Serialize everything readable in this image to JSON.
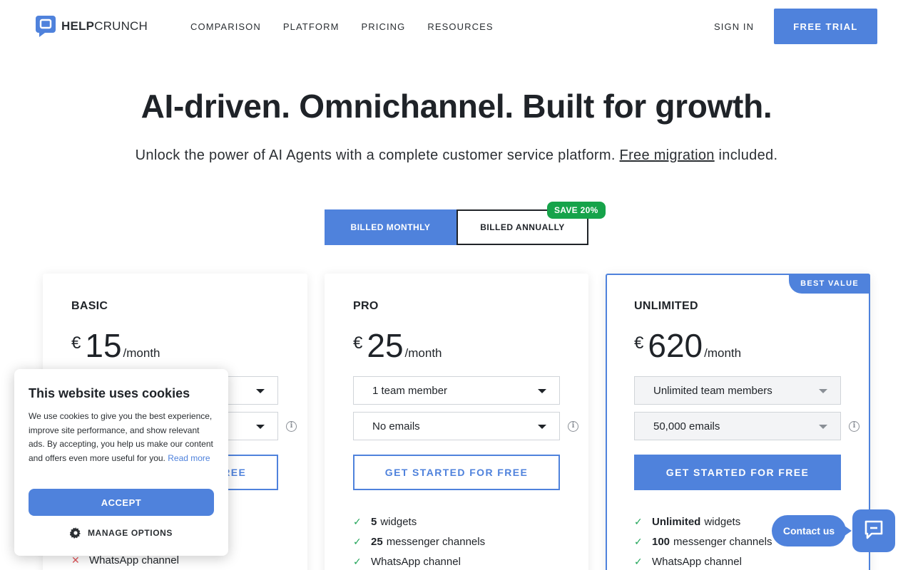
{
  "nav": {
    "logo_bold": "HELP",
    "logo_light": "CRUNCH",
    "links": [
      "COMPARISON",
      "PLATFORM",
      "PRICING",
      "RESOURCES"
    ],
    "sign_in": "SIGN IN",
    "free_trial": "FREE TRIAL"
  },
  "hero": {
    "title": "AI-driven. Omnichannel. Built for growth.",
    "sub_before": "Unlock the power of AI Agents with a complete customer service platform. ",
    "sub_link": "Free migration",
    "sub_after": " included."
  },
  "billing": {
    "monthly": "BILLED MONTHLY",
    "annually": "BILLED ANNUALLY",
    "save_badge": "SAVE 20%",
    "selected": "monthly"
  },
  "plans": [
    {
      "name": "BASIC",
      "currency": "€",
      "amount": "15",
      "per": "/month",
      "select1": "",
      "select2": "",
      "cta": "GET STARTED FOR FREE",
      "features": [
        {
          "mark": "x",
          "bold": "",
          "text": "WhatsApp channel"
        }
      ]
    },
    {
      "name": "PRO",
      "currency": "€",
      "amount": "25",
      "per": "/month",
      "select1": "1 team member",
      "select2": "No emails",
      "cta": "GET STARTED FOR FREE",
      "features": [
        {
          "mark": "check",
          "bold": "5",
          "text": "widgets"
        },
        {
          "mark": "check",
          "bold": "25",
          "text": "messenger channels"
        },
        {
          "mark": "check",
          "bold": "",
          "text": "WhatsApp channel"
        }
      ]
    },
    {
      "name": "UNLIMITED",
      "currency": "€",
      "amount": "620",
      "per": "/month",
      "select1": "Unlimited team members",
      "select2": "50,000 emails",
      "cta": "GET STARTED FOR FREE",
      "badge": "BEST VALUE",
      "features": [
        {
          "mark": "check",
          "bold": "Unlimited",
          "text": "widgets"
        },
        {
          "mark": "check",
          "bold": "100",
          "text": "messenger channels"
        },
        {
          "mark": "check",
          "bold": "",
          "text": "WhatsApp channel"
        }
      ]
    }
  ],
  "cookie": {
    "title": "This website uses cookies",
    "body": "We use cookies to give you the best experience, improve site performance, and show relevant ads. By accepting, you help us make our content and offers even more useful for you. ",
    "read_more": "Read more",
    "accept": "ACCEPT",
    "manage": "MANAGE OPTIONS"
  },
  "contact": {
    "label": "Contact us"
  },
  "colors": {
    "accent": "#4f82dc",
    "save_green": "#16a34a",
    "check_green": "#22a55a",
    "cross_red": "#e0545a"
  }
}
